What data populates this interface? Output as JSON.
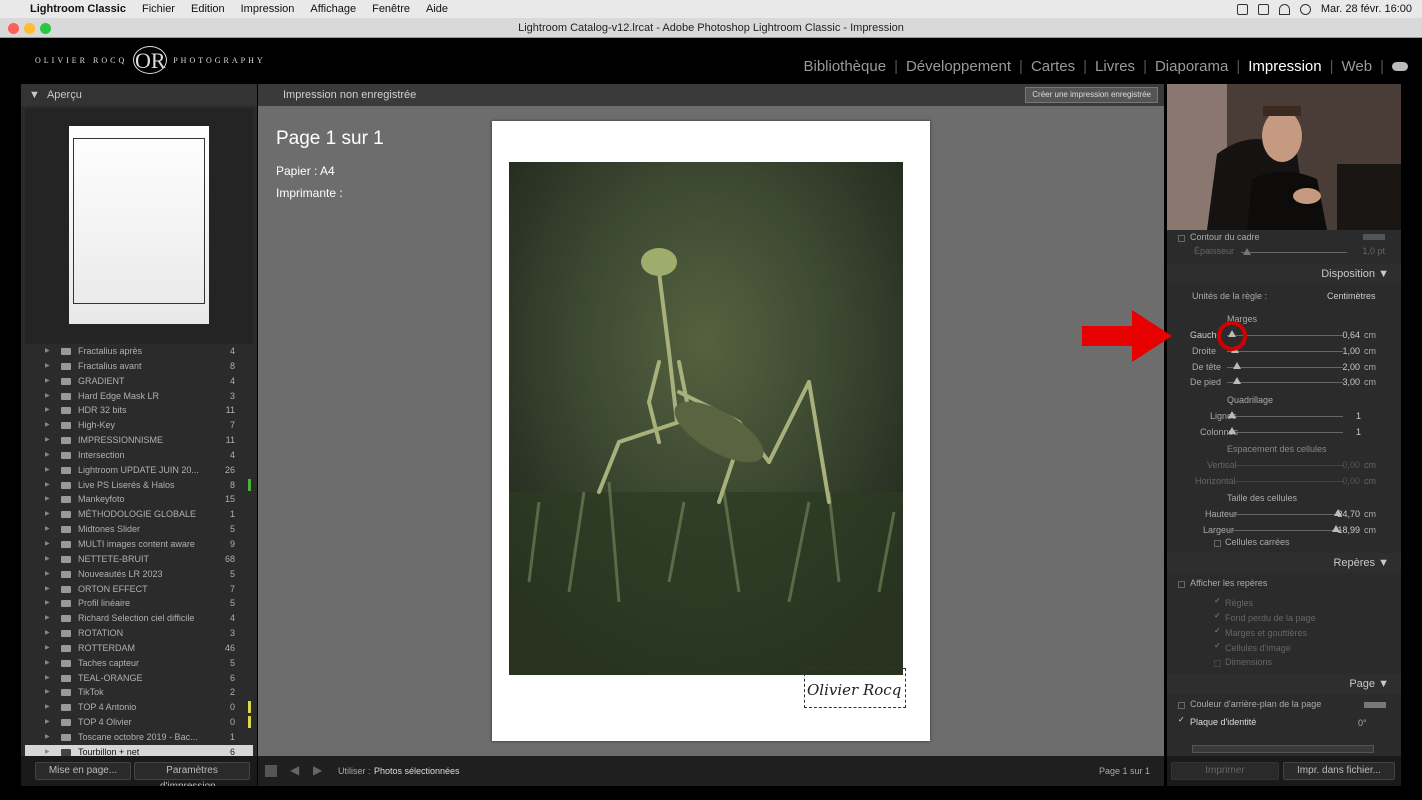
{
  "menubar": {
    "app": "Lightroom Classic",
    "items": [
      "Fichier",
      "Edition",
      "Impression",
      "Affichage",
      "Fenêtre",
      "Aide"
    ],
    "datetime": "Mar. 28 févr.  16:00"
  },
  "window": {
    "title": "Lightroom Catalog-v12.lrcat - Adobe Photoshop Lightroom Classic - Impression"
  },
  "brand": {
    "left": "OLIVIER ROCQ",
    "mono": "OR",
    "right": "PHOTOGRAPHY"
  },
  "modules": [
    "Bibliothèque",
    "Développement",
    "Cartes",
    "Livres",
    "Diaporama",
    "Impression",
    "Web"
  ],
  "active_module": "Impression",
  "left": {
    "preview_title": "Aperçu",
    "templates": [
      {
        "name": "Fractalius après",
        "count": "4"
      },
      {
        "name": "Fractalius avant",
        "count": "8"
      },
      {
        "name": "GRADIENT",
        "count": "4"
      },
      {
        "name": "Hard Edge Mask LR",
        "count": "3"
      },
      {
        "name": "HDR 32 bits",
        "count": "11"
      },
      {
        "name": "High-Key",
        "count": "7"
      },
      {
        "name": "IMPRESSIONNISME",
        "count": "11"
      },
      {
        "name": "Intersection",
        "count": "4"
      },
      {
        "name": "Lightroom UPDATE JUIN 20...",
        "count": "26"
      },
      {
        "name": "Live PS Liserés & Halos",
        "count": "8",
        "marker": "#4caf3a"
      },
      {
        "name": "Mankeyfoto",
        "count": "15"
      },
      {
        "name": "MÉTHODOLOGIE GLOBALE",
        "count": "1"
      },
      {
        "name": "Midtones Slider",
        "count": "5"
      },
      {
        "name": "MULTI images content aware",
        "count": "9"
      },
      {
        "name": "NETTETE-BRUIT",
        "count": "68"
      },
      {
        "name": "Nouveautés LR 2023",
        "count": "5"
      },
      {
        "name": "ORTON EFFECT",
        "count": "7"
      },
      {
        "name": "Profil linéaire",
        "count": "5"
      },
      {
        "name": "Richard Selection ciel difficile",
        "count": "4"
      },
      {
        "name": "ROTATION",
        "count": "3"
      },
      {
        "name": "ROTTERDAM",
        "count": "46"
      },
      {
        "name": "Taches capteur",
        "count": "5"
      },
      {
        "name": "TEAL-ORANGE",
        "count": "6"
      },
      {
        "name": "TikTok",
        "count": "2"
      },
      {
        "name": "TOP 4 Antonio",
        "count": "0",
        "marker": "#d8d84a"
      },
      {
        "name": "TOP 4 Olivier",
        "count": "0",
        "marker": "#d8d84a"
      },
      {
        "name": "Toscane octobre 2019 - Bac...",
        "count": "1"
      },
      {
        "name": "Tourbillon + net",
        "count": "6",
        "selected": true
      }
    ],
    "btn_layout": "Mise en page...",
    "btn_print_settings": "Paramètres d'impression..."
  },
  "center": {
    "toolbar_title": "Impression non enregistrée",
    "save_button": "Créer une impression enregistrée",
    "page_title": "Page 1 sur 1",
    "paper": "Papier : A4",
    "printer": "Imprimante :",
    "signature": "Olivier Rocq",
    "use_label": "Utiliser :",
    "use_value": "Photos sélectionnées",
    "page_status": "Page 1 sur 1"
  },
  "right": {
    "frame_outline": "Contour du cadre",
    "thickness_label": "Épaisseur",
    "thickness_value": "1,0 pt",
    "section_layout": "Disposition",
    "ruler_units_label": "Unités de la règle :",
    "ruler_units_value": "Centimètres",
    "margins_title": "Marges",
    "margins": [
      {
        "label": "Gauche",
        "value": "0,64",
        "unit": "cm"
      },
      {
        "label": "Droite",
        "value": "1,00",
        "unit": "cm"
      },
      {
        "label": "De tête",
        "value": "2,00",
        "unit": "cm"
      },
      {
        "label": "De pied",
        "value": "3,00",
        "unit": "cm"
      }
    ],
    "grid_title": "Quadrillage",
    "grid": [
      {
        "label": "Lignes",
        "value": "1"
      },
      {
        "label": "Colonnes",
        "value": "1"
      }
    ],
    "spacing_title": "Espacement des cellules",
    "spacing": [
      {
        "label": "Vertical",
        "value": "0,00",
        "unit": "cm"
      },
      {
        "label": "Horizontal",
        "value": "0,00",
        "unit": "cm"
      }
    ],
    "cellsize_title": "Taille des cellules",
    "cellsize": [
      {
        "label": "Hauteur",
        "value": "24,70",
        "unit": "cm"
      },
      {
        "label": "Largeur",
        "value": "18,99",
        "unit": "cm"
      }
    ],
    "square_cells": "Cellules carrées",
    "section_guides": "Repères",
    "show_guides": "Afficher les repères",
    "guides": [
      "Règles",
      "Fond perdu de la page",
      "Marges et gouttières",
      "Cellules d'image",
      "Dimensions"
    ],
    "section_page": "Page",
    "page_bg_color": "Couleur d'arrière-plan de la page",
    "identity_plate": "Plaque d'identité",
    "identity_angle": "0°",
    "btn_print": "Imprimer",
    "btn_print_file": "Impr. dans fichier..."
  },
  "colors": {
    "accent_red": "#e60000",
    "panel": "#2b2b2b",
    "canvas": "#6d6d6d"
  }
}
